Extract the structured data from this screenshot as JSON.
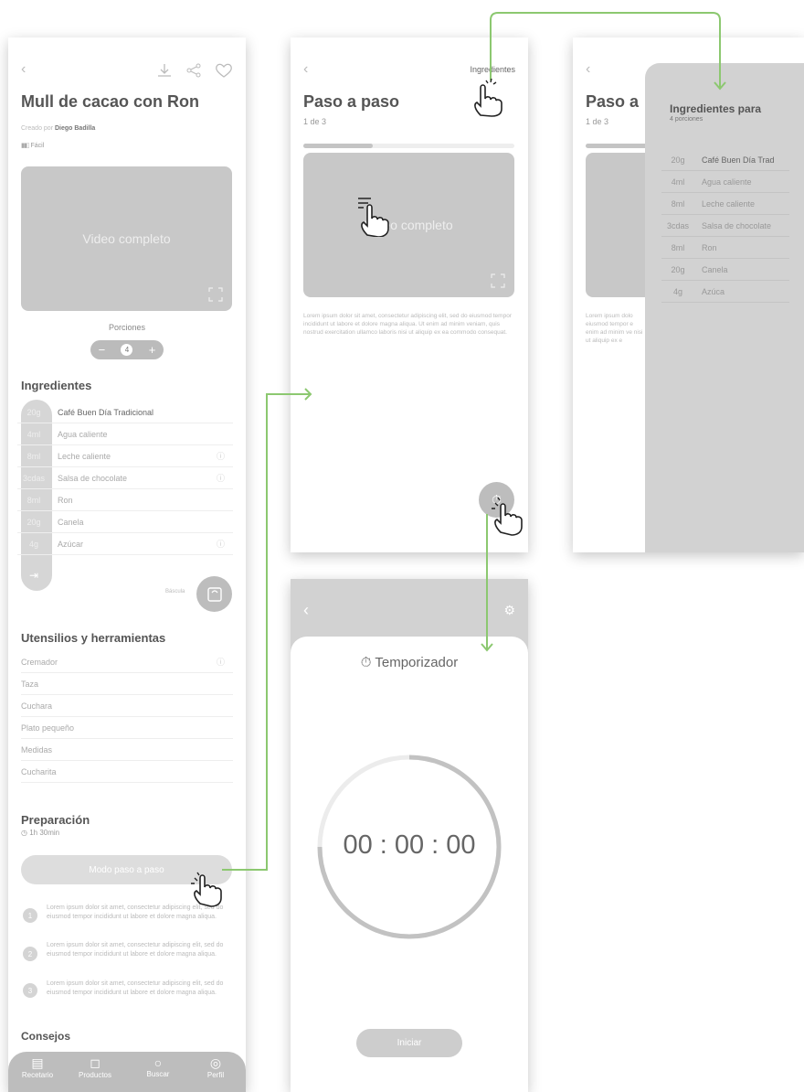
{
  "screen1": {
    "title": "Mull de cacao con Ron",
    "created_prefix": "Creado por",
    "author": "Diego Badilla",
    "difficulty": "Fácil",
    "video_label": "Video completo",
    "portions_label": "Porciones",
    "portions_value": "4",
    "ingredients_heading": "Ingredientes",
    "ingredients": [
      {
        "qty": "20g",
        "name": "Café Buen Día Tradicional"
      },
      {
        "qty": "4ml",
        "name": "Agua caliente"
      },
      {
        "qty": "8ml",
        "name": "Leche caliente"
      },
      {
        "qty": "3cdas",
        "name": "Salsa de chocolate"
      },
      {
        "qty": "8ml",
        "name": "Ron"
      },
      {
        "qty": "20g",
        "name": "Canela"
      },
      {
        "qty": "4g",
        "name": "Azúcar"
      }
    ],
    "scale_label": "Báscula",
    "tools_heading": "Utensilios y herramientas",
    "tools": [
      "Cremador",
      "Taza",
      "Cuchara",
      "Plato pequeño",
      "Medidas",
      "Cucharita"
    ],
    "prep_heading": "Preparación",
    "prep_time": "1h 30min",
    "step_mode_button": "Modo paso a paso",
    "steps": [
      {
        "n": "1",
        "text": "Lorem ipsum dolor sit amet, consectetur adipiscing elit, sed do eiusmod tempor incididunt ut labore et dolore magna aliqua."
      },
      {
        "n": "2",
        "text": "Lorem ipsum dolor sit amet, consectetur adipiscing elit, sed do eiusmod tempor incididunt ut labore et dolore magna aliqua."
      },
      {
        "n": "3",
        "text": "Lorem ipsum dolor sit amet, consectetur adipiscing elit, sed do eiusmod tempor incididunt ut labore et dolore magna aliqua."
      }
    ],
    "tips_heading": "Consejos",
    "tabs": [
      "Recetario",
      "Productos",
      "Buscar",
      "Perfil"
    ]
  },
  "screen2": {
    "ingredients_link": "Ingredientes",
    "title": "Paso a paso",
    "counter": "1 de 3",
    "progress": 0.33,
    "video_label": "Video completo",
    "body": "Lorem ipsum dolor sit amet, consectetur adipiscing elit, sed do eiusmod tempor incididunt ut labore et dolore magna aliqua. Ut enim ad minim veniam, quis nostrud exercitation ullamco laboris nisi ut aliquip ex ea commodo consequat."
  },
  "screen3": {
    "title": "Paso a",
    "counter": "1 de 3",
    "body": "Lorem ipsum dolo eiusmod tempor e enim ad minim ve nisi ut aliquip ex e",
    "sheet_title": "Ingredientes para",
    "sheet_subtitle": "4 porciones",
    "ingredients": [
      {
        "qty": "20g",
        "name": "Café Buen Día Trad"
      },
      {
        "qty": "4ml",
        "name": "Agua caliente"
      },
      {
        "qty": "8ml",
        "name": "Leche caliente"
      },
      {
        "qty": "3cdas",
        "name": "Salsa de chocolate"
      },
      {
        "qty": "8ml",
        "name": "Ron"
      },
      {
        "qty": "20g",
        "name": "Canela"
      },
      {
        "qty": "4g",
        "name": "Azúca"
      }
    ]
  },
  "screen4": {
    "timer_title": "Temporizador",
    "time": "00 : 00 : 00",
    "start_button": "Iniciar"
  },
  "colors": {
    "connector": "#8cc870",
    "panel": "#d2d2d2",
    "pill": "#dcdcdc"
  }
}
